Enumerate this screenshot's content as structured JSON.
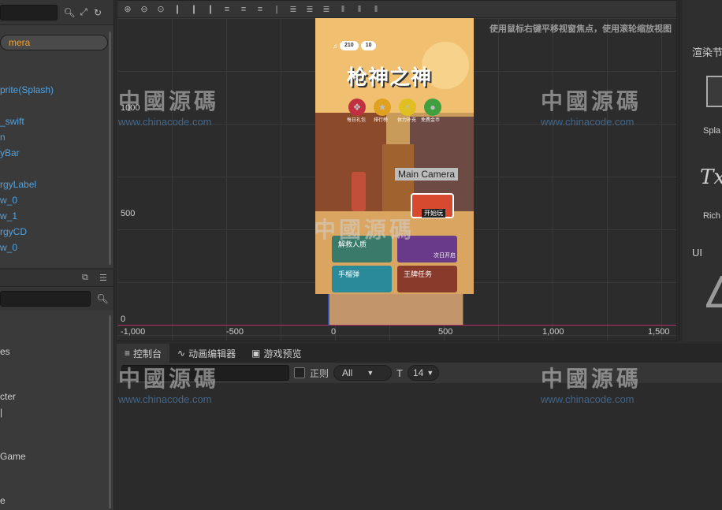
{
  "hierarchy": {
    "items": [
      "mera",
      "",
      "",
      "prite(Splash)",
      "",
      "_swift",
      "n",
      "yBar",
      "",
      "rgyLabel",
      "w_0",
      "w_1",
      "rgyCD",
      "w_0"
    ],
    "selected_index": 0
  },
  "assets": {
    "items": [
      "es",
      "cter",
      "|",
      "Game",
      "e"
    ]
  },
  "scene": {
    "hint": "使用鼠标右键平移视窗焦点，使用滚轮缩放视图",
    "x_ticks": [
      "-1,000",
      "-500",
      "0",
      "500",
      "1,000",
      "1,500"
    ],
    "y_ticks": [
      "1000",
      "500",
      "0"
    ],
    "camera_label": "Main Camera"
  },
  "game": {
    "hud_coins": "210",
    "hud_diamond": "10",
    "title": "枪神之神",
    "icon_labels": [
      "每日礼包",
      "排行榜",
      "体力补充",
      "免费金币"
    ],
    "start_button": "开始玩",
    "tiles": [
      "解救人质",
      "",
      "手榴弹",
      "王牌任务"
    ],
    "next_day": "次日开启"
  },
  "right_panel": {
    "title": "渲染节",
    "splash": "Spla",
    "rich": "Rich",
    "ui": "UI",
    "tx": "Tx"
  },
  "console": {
    "tabs": [
      "控制台",
      "动画编辑器",
      "游戏预览"
    ],
    "regex_label": "正则",
    "level": "All",
    "font_size": "14"
  },
  "watermark": {
    "cn": "中國源碼",
    "url": "www.chinacode.com"
  }
}
